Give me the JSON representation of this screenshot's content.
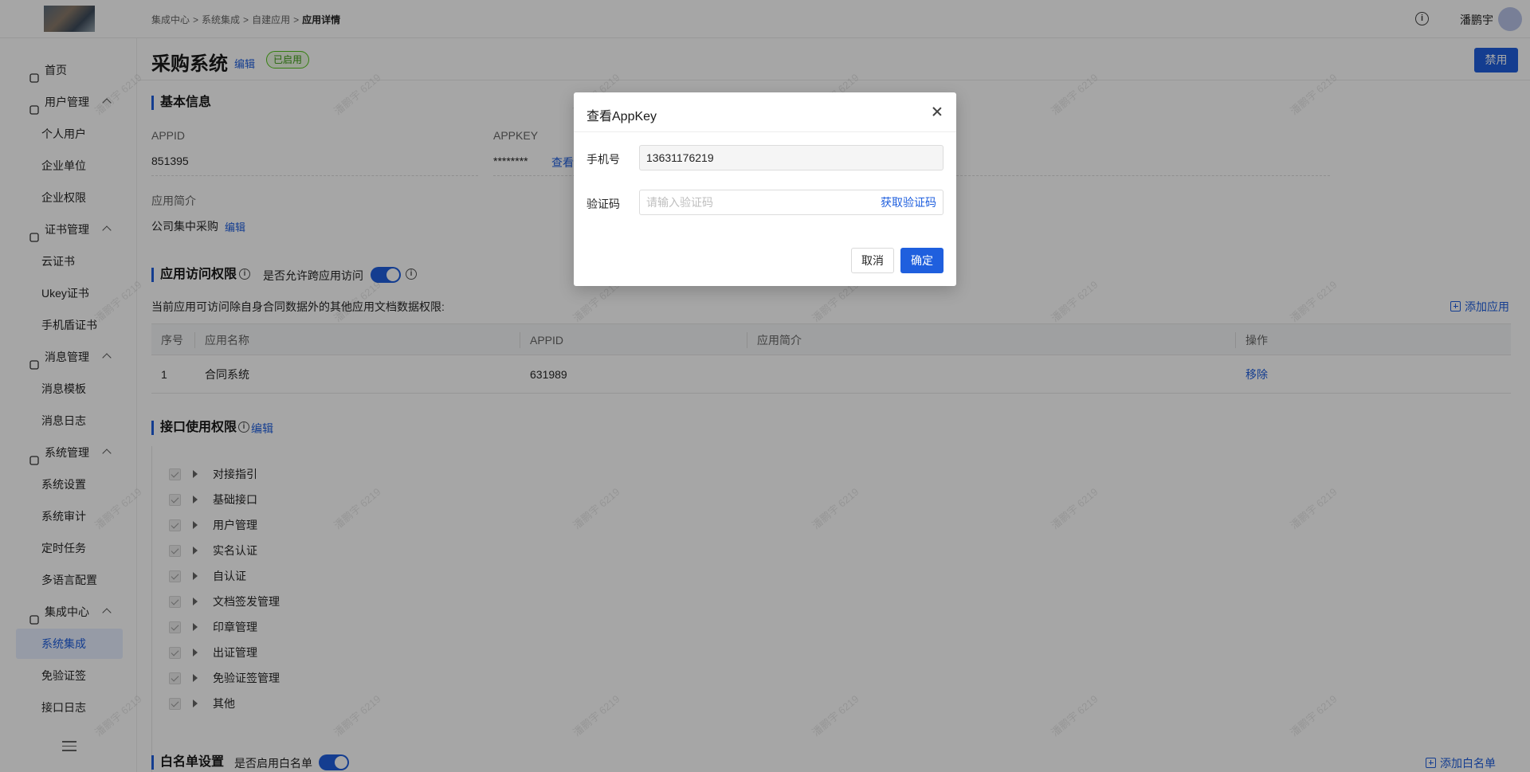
{
  "breadcrumb": [
    "集成中心",
    "系统集成",
    "自建应用",
    "应用详情"
  ],
  "breadcrumb_sep": ">",
  "header": {
    "user_name": "潘鹏宇"
  },
  "sidebar": {
    "items": [
      {
        "label": "首页",
        "type": "top",
        "icon": "home-icon"
      },
      {
        "label": "用户管理",
        "type": "group",
        "icon": "user-group-icon"
      },
      {
        "label": "个人用户",
        "type": "child"
      },
      {
        "label": "企业单位",
        "type": "child"
      },
      {
        "label": "企业权限",
        "type": "child"
      },
      {
        "label": "证书管理",
        "type": "group",
        "icon": "certificate-icon"
      },
      {
        "label": "云证书",
        "type": "child"
      },
      {
        "label": "Ukey证书",
        "type": "child"
      },
      {
        "label": "手机盾证书",
        "type": "child"
      },
      {
        "label": "消息管理",
        "type": "group",
        "icon": "bell-icon"
      },
      {
        "label": "消息模板",
        "type": "child"
      },
      {
        "label": "消息日志",
        "type": "child"
      },
      {
        "label": "系统管理",
        "type": "group",
        "icon": "system-icon"
      },
      {
        "label": "系统设置",
        "type": "child"
      },
      {
        "label": "系统审计",
        "type": "child"
      },
      {
        "label": "定时任务",
        "type": "child"
      },
      {
        "label": "多语言配置",
        "type": "child"
      },
      {
        "label": "集成中心",
        "type": "group",
        "icon": "layers-icon"
      },
      {
        "label": "系统集成",
        "type": "child",
        "active": true
      },
      {
        "label": "免验证签",
        "type": "child"
      },
      {
        "label": "接口日志",
        "type": "child"
      }
    ]
  },
  "page": {
    "title": "采购系统",
    "edit_label": "编辑",
    "status": "已启用",
    "disable_label": "禁用"
  },
  "basic_info": {
    "section_title": "基本信息",
    "appid_label": "APPID",
    "appid_value": "851395",
    "appkey_label": "APPKEY",
    "appkey_value": "********",
    "appkey_view": "查看",
    "intro_label": "应用简介",
    "intro_value": "公司集中采购",
    "intro_edit": "编辑"
  },
  "access": {
    "section_title": "应用访问权限",
    "cross_label": "是否允许跨应用访问",
    "desc": "当前应用可访问除自身合同数据外的其他应用文档数据权限:",
    "add_label": "添加应用",
    "columns": [
      "序号",
      "应用名称",
      "APPID",
      "应用简介",
      "操作"
    ],
    "rows": [
      {
        "index": "1",
        "name": "合同系统",
        "appid": "631989",
        "intro": "",
        "action": "移除"
      }
    ]
  },
  "api_perm": {
    "section_title": "接口使用权限",
    "edit_label": "编辑",
    "items": [
      "对接指引",
      "基础接口",
      "用户管理",
      "实名认证",
      "自认证",
      "文档签发管理",
      "印章管理",
      "出证管理",
      "免验证签管理",
      "其他"
    ]
  },
  "whitelist": {
    "section_title": "白名单设置",
    "enable_label": "是否启用白名单",
    "add_label": "添加白名单"
  },
  "watermark": "潘鹏宇 6219",
  "dialog": {
    "title": "查看AppKey",
    "phone_label": "手机号",
    "phone_value": "13631176219",
    "code_label": "验证码",
    "code_placeholder": "请输入验证码",
    "get_code": "获取验证码",
    "cancel": "取消",
    "ok": "确定"
  },
  "colors": {
    "primary": "#1f5fde",
    "success": "#52c41a",
    "mask": "rgba(0,0,0,0.35)"
  }
}
